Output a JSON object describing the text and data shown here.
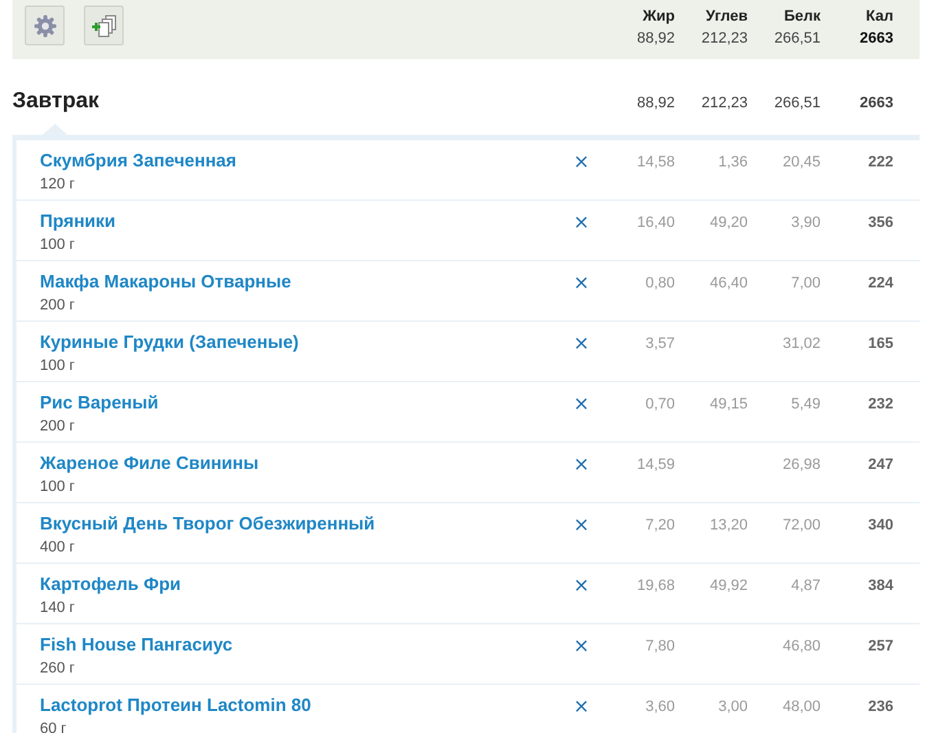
{
  "toolbar": {
    "columns": [
      {
        "label": "Жир",
        "value": "88,92"
      },
      {
        "label": "Углев",
        "value": "212,23"
      },
      {
        "label": "Белк",
        "value": "266,51"
      },
      {
        "label": "Кал",
        "value": "2663"
      }
    ]
  },
  "meal": {
    "title": "Завтрак",
    "totals": [
      "88,92",
      "212,23",
      "266,51",
      "2663"
    ],
    "items": [
      {
        "name": "Скумбрия Запеченная",
        "amount": "120 г",
        "remove": "×",
        "fat": "14,58",
        "carbs": "1,36",
        "protein": "20,45",
        "kcal": "222"
      },
      {
        "name": "Пряники",
        "amount": "100 г",
        "remove": "×",
        "fat": "16,40",
        "carbs": "49,20",
        "protein": "3,90",
        "kcal": "356"
      },
      {
        "name": "Макфа Макароны Отварные",
        "amount": "200 г",
        "remove": "×",
        "fat": "0,80",
        "carbs": "46,40",
        "protein": "7,00",
        "kcal": "224"
      },
      {
        "name": "Куриные Грудки (Запеченые)",
        "amount": "100 г",
        "remove": "×",
        "fat": "3,57",
        "protein": "31,02",
        "kcal": "165"
      },
      {
        "name": "Рис Вареный",
        "amount": "200 г",
        "remove": "×",
        "fat": "0,70",
        "carbs": "49,15",
        "protein": "5,49",
        "kcal": "232"
      },
      {
        "name": "Жареное Филе Свинины",
        "amount": "100 г",
        "remove": "×",
        "fat": "14,59",
        "protein": "26,98",
        "kcal": "247"
      },
      {
        "name": "Вкусный День Творог Обезжиренный",
        "amount": "400 г",
        "remove": "×",
        "fat": "7,20",
        "carbs": "13,20",
        "protein": "72,00",
        "kcal": "340"
      },
      {
        "name": "Картофель Фри",
        "amount": "140 г",
        "remove": "×",
        "fat": "19,68",
        "carbs": "49,92",
        "protein": "4,87",
        "kcal": "384"
      },
      {
        "name": "Fish House Пангасиус",
        "amount": "260 г",
        "remove": "×",
        "fat": "7,80",
        "protein": "46,80",
        "kcal": "257"
      },
      {
        "name": "Lactoprot Протеин Lactomin 80",
        "amount": "60 г",
        "remove": "×",
        "fat": "3,60",
        "carbs": "3,00",
        "protein": "48,00",
        "kcal": "236"
      }
    ]
  }
}
